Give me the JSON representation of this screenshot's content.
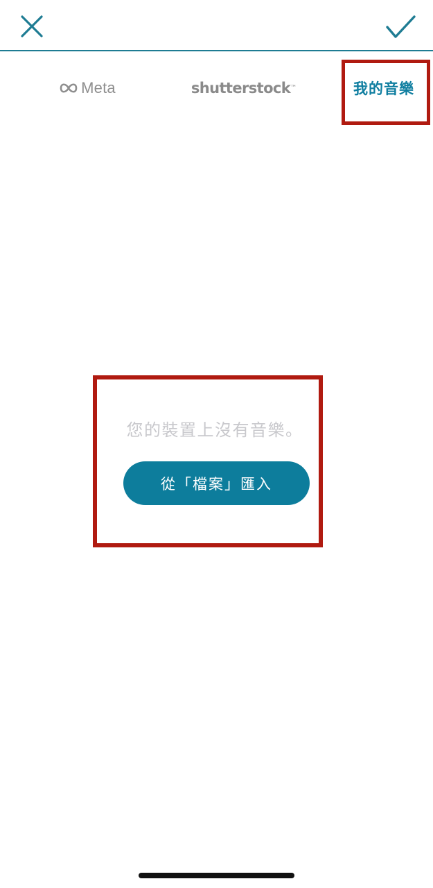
{
  "header": {
    "close_icon": "close-icon",
    "confirm_icon": "checkmark-icon",
    "accent_color": "#1e7c93"
  },
  "tabs": [
    {
      "label": "Meta",
      "icon": "meta-infinity-logo"
    },
    {
      "label": "shutterstock",
      "mark": "™"
    },
    {
      "label": "我的音樂",
      "active": true
    }
  ],
  "empty_state": {
    "message": "您的裝置上沒有音樂。",
    "import_button": "從「檔案」匯入",
    "button_color": "#0d7d9c"
  },
  "highlight_color": "#b01a10"
}
